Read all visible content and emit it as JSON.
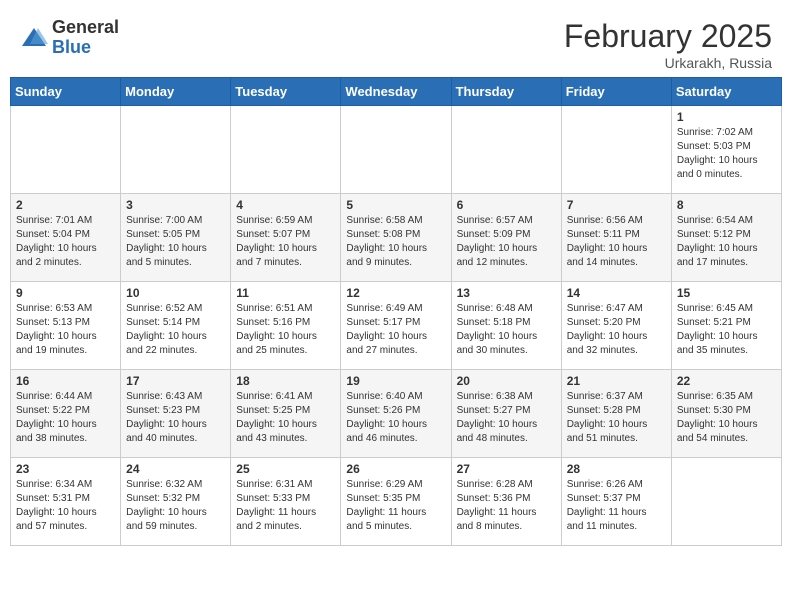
{
  "header": {
    "logo_general": "General",
    "logo_blue": "Blue",
    "month_title": "February 2025",
    "location": "Urkarakh, Russia"
  },
  "weekdays": [
    "Sunday",
    "Monday",
    "Tuesday",
    "Wednesday",
    "Thursday",
    "Friday",
    "Saturday"
  ],
  "weeks": [
    [
      {
        "day": "",
        "info": ""
      },
      {
        "day": "",
        "info": ""
      },
      {
        "day": "",
        "info": ""
      },
      {
        "day": "",
        "info": ""
      },
      {
        "day": "",
        "info": ""
      },
      {
        "day": "",
        "info": ""
      },
      {
        "day": "1",
        "info": "Sunrise: 7:02 AM\nSunset: 5:03 PM\nDaylight: 10 hours\nand 0 minutes."
      }
    ],
    [
      {
        "day": "2",
        "info": "Sunrise: 7:01 AM\nSunset: 5:04 PM\nDaylight: 10 hours\nand 2 minutes."
      },
      {
        "day": "3",
        "info": "Sunrise: 7:00 AM\nSunset: 5:05 PM\nDaylight: 10 hours\nand 5 minutes."
      },
      {
        "day": "4",
        "info": "Sunrise: 6:59 AM\nSunset: 5:07 PM\nDaylight: 10 hours\nand 7 minutes."
      },
      {
        "day": "5",
        "info": "Sunrise: 6:58 AM\nSunset: 5:08 PM\nDaylight: 10 hours\nand 9 minutes."
      },
      {
        "day": "6",
        "info": "Sunrise: 6:57 AM\nSunset: 5:09 PM\nDaylight: 10 hours\nand 12 minutes."
      },
      {
        "day": "7",
        "info": "Sunrise: 6:56 AM\nSunset: 5:11 PM\nDaylight: 10 hours\nand 14 minutes."
      },
      {
        "day": "8",
        "info": "Sunrise: 6:54 AM\nSunset: 5:12 PM\nDaylight: 10 hours\nand 17 minutes."
      }
    ],
    [
      {
        "day": "9",
        "info": "Sunrise: 6:53 AM\nSunset: 5:13 PM\nDaylight: 10 hours\nand 19 minutes."
      },
      {
        "day": "10",
        "info": "Sunrise: 6:52 AM\nSunset: 5:14 PM\nDaylight: 10 hours\nand 22 minutes."
      },
      {
        "day": "11",
        "info": "Sunrise: 6:51 AM\nSunset: 5:16 PM\nDaylight: 10 hours\nand 25 minutes."
      },
      {
        "day": "12",
        "info": "Sunrise: 6:49 AM\nSunset: 5:17 PM\nDaylight: 10 hours\nand 27 minutes."
      },
      {
        "day": "13",
        "info": "Sunrise: 6:48 AM\nSunset: 5:18 PM\nDaylight: 10 hours\nand 30 minutes."
      },
      {
        "day": "14",
        "info": "Sunrise: 6:47 AM\nSunset: 5:20 PM\nDaylight: 10 hours\nand 32 minutes."
      },
      {
        "day": "15",
        "info": "Sunrise: 6:45 AM\nSunset: 5:21 PM\nDaylight: 10 hours\nand 35 minutes."
      }
    ],
    [
      {
        "day": "16",
        "info": "Sunrise: 6:44 AM\nSunset: 5:22 PM\nDaylight: 10 hours\nand 38 minutes."
      },
      {
        "day": "17",
        "info": "Sunrise: 6:43 AM\nSunset: 5:23 PM\nDaylight: 10 hours\nand 40 minutes."
      },
      {
        "day": "18",
        "info": "Sunrise: 6:41 AM\nSunset: 5:25 PM\nDaylight: 10 hours\nand 43 minutes."
      },
      {
        "day": "19",
        "info": "Sunrise: 6:40 AM\nSunset: 5:26 PM\nDaylight: 10 hours\nand 46 minutes."
      },
      {
        "day": "20",
        "info": "Sunrise: 6:38 AM\nSunset: 5:27 PM\nDaylight: 10 hours\nand 48 minutes."
      },
      {
        "day": "21",
        "info": "Sunrise: 6:37 AM\nSunset: 5:28 PM\nDaylight: 10 hours\nand 51 minutes."
      },
      {
        "day": "22",
        "info": "Sunrise: 6:35 AM\nSunset: 5:30 PM\nDaylight: 10 hours\nand 54 minutes."
      }
    ],
    [
      {
        "day": "23",
        "info": "Sunrise: 6:34 AM\nSunset: 5:31 PM\nDaylight: 10 hours\nand 57 minutes."
      },
      {
        "day": "24",
        "info": "Sunrise: 6:32 AM\nSunset: 5:32 PM\nDaylight: 10 hours\nand 59 minutes."
      },
      {
        "day": "25",
        "info": "Sunrise: 6:31 AM\nSunset: 5:33 PM\nDaylight: 11 hours\nand 2 minutes."
      },
      {
        "day": "26",
        "info": "Sunrise: 6:29 AM\nSunset: 5:35 PM\nDaylight: 11 hours\nand 5 minutes."
      },
      {
        "day": "27",
        "info": "Sunrise: 6:28 AM\nSunset: 5:36 PM\nDaylight: 11 hours\nand 8 minutes."
      },
      {
        "day": "28",
        "info": "Sunrise: 6:26 AM\nSunset: 5:37 PM\nDaylight: 11 hours\nand 11 minutes."
      },
      {
        "day": "",
        "info": ""
      }
    ]
  ]
}
